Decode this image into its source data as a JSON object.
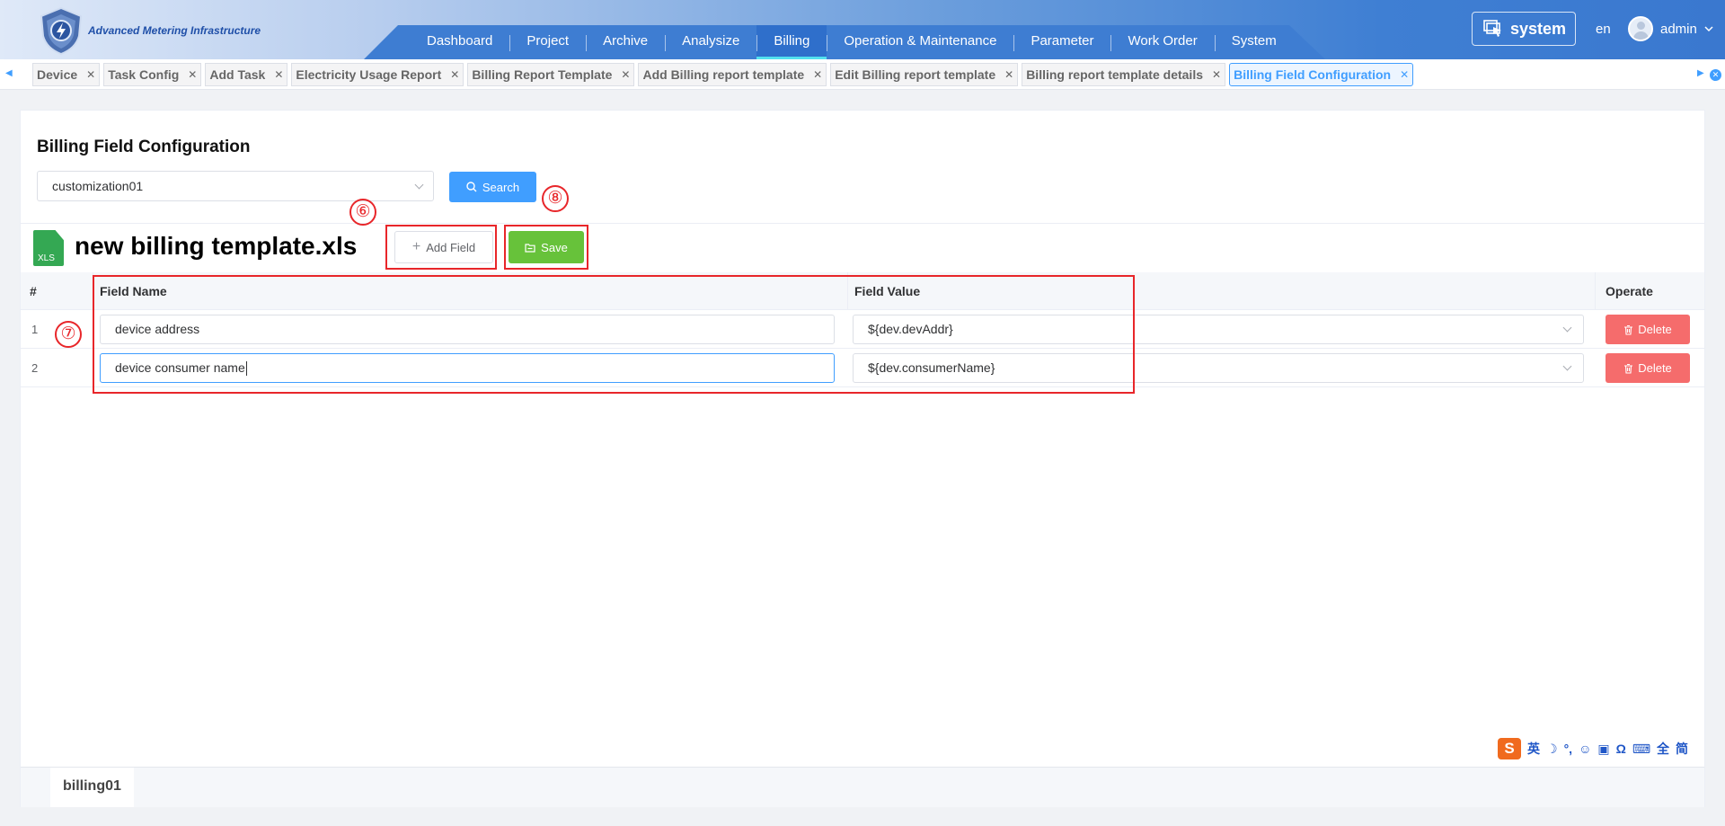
{
  "header": {
    "app_title": "Advanced Metering Infrastructure",
    "nav": [
      {
        "label": "Dashboard"
      },
      {
        "label": "Project"
      },
      {
        "label": "Archive"
      },
      {
        "label": "Analysize"
      },
      {
        "label": "Billing"
      },
      {
        "label": "Operation & Maintenance"
      },
      {
        "label": "Parameter"
      },
      {
        "label": "Work Order"
      },
      {
        "label": "System"
      }
    ],
    "active_nav": "Billing",
    "system_label": "system",
    "language": "en",
    "user": "admin"
  },
  "tabs": [
    {
      "label": "Device"
    },
    {
      "label": "Task Config"
    },
    {
      "label": "Add Task"
    },
    {
      "label": "Electricity Usage Report"
    },
    {
      "label": "Billing Report Template"
    },
    {
      "label": "Add Billing report template"
    },
    {
      "label": "Edit Billing report template"
    },
    {
      "label": "Billing report template details"
    },
    {
      "label": "Billing Field Configuration"
    }
  ],
  "active_tab": "Billing Field Configuration",
  "page": {
    "title": "Billing Field Configuration",
    "select_value": "customization01",
    "search_label": "Search",
    "file_name": "new billing template.xls",
    "xls_label": "XLS",
    "add_field_label": "Add Field",
    "save_label": "Save"
  },
  "table": {
    "headers": {
      "index": "#",
      "field_name": "Field Name",
      "field_value": "Field Value",
      "operate": "Operate"
    },
    "rows": [
      {
        "index": "1",
        "field_name": "device address",
        "field_value": "${dev.devAddr}",
        "delete_label": "Delete"
      },
      {
        "index": "2",
        "field_name": "device consumer name",
        "field_value": "${dev.consumerName}",
        "delete_label": "Delete"
      }
    ]
  },
  "annotations": {
    "six": "⑥",
    "seven": "⑦",
    "eight": "⑧"
  },
  "sheet_tab": "billing01",
  "ime": {
    "logo": "S",
    "glyphs": [
      "英",
      "☽",
      "°,",
      "☺",
      "▣",
      "Ω",
      "⌨",
      "全",
      "简"
    ]
  },
  "colors": {
    "primary": "#409eff",
    "success": "#67c23a",
    "danger": "#f56c6c",
    "annotation": "#e8262a"
  }
}
